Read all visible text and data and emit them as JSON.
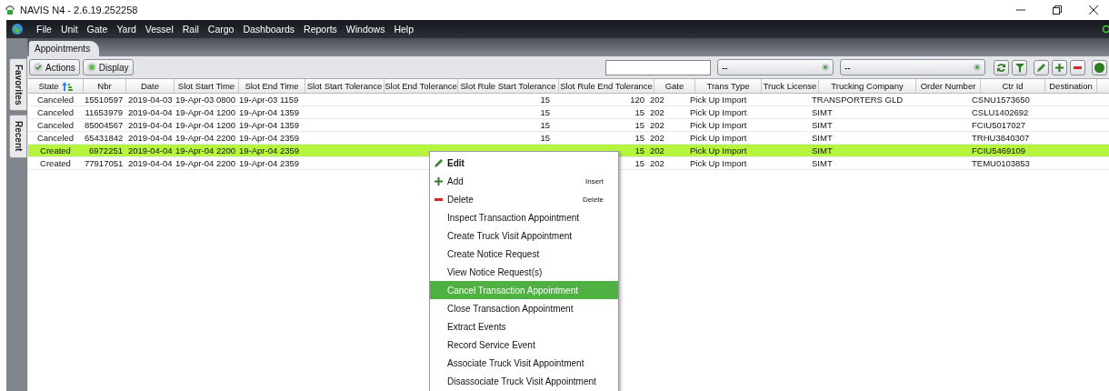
{
  "window": {
    "title": "NAVIS N4 - 2.6.19.252258"
  },
  "menu_bar": [
    "File",
    "Unit",
    "Gate",
    "Yard",
    "Vessel",
    "Rail",
    "Cargo",
    "Dashboards",
    "Reports",
    "Windows",
    "Help"
  ],
  "side_tabs": [
    "Favorites",
    "Recent"
  ],
  "tabs": [
    {
      "label": "Appointments",
      "selected": true
    }
  ],
  "toolbar": {
    "buttons": [
      {
        "label": "Actions",
        "kind": "check"
      },
      {
        "label": "Display",
        "kind": "square"
      }
    ],
    "dropdowns": [
      "--",
      "--"
    ]
  },
  "table": {
    "columns": [
      {
        "label": "State",
        "sorted": true
      },
      {
        "label": "Nbr",
        "sorted": false
      },
      {
        "label": "Date",
        "sorted": false
      },
      {
        "label": "Slot Start Time",
        "sorted": false
      },
      {
        "label": "Slot End Time",
        "sorted": false
      },
      {
        "label": "Slot Start Tolerance",
        "sorted": false
      },
      {
        "label": "Slot End Tolerance",
        "sorted": false
      },
      {
        "label": "Slot Rule Start Tolerance",
        "sorted": false
      },
      {
        "label": "Slot Rule End Tolerance",
        "sorted": false
      },
      {
        "label": "Gate",
        "sorted": false
      },
      {
        "label": "Trans Type",
        "sorted": false
      },
      {
        "label": "Truck License",
        "sorted": false
      },
      {
        "label": "Trucking Company",
        "sorted": false
      },
      {
        "label": "Order Number",
        "sorted": false
      },
      {
        "label": "Ctr Id",
        "sorted": false
      },
      {
        "label": "Destination",
        "sorted": false
      }
    ],
    "rows": [
      {
        "selected": false,
        "state": "Canceled",
        "nbr": "15510597",
        "date": "2019-04-03",
        "slot_start_time": "19-Apr-03 0800",
        "slot_end_time": "19-Apr-03 1159",
        "slot_rule_start_tolerance": "15",
        "slot_rule_end_tolerance": "120",
        "gate": "202",
        "trans_type": "Pick Up Import",
        "trucking_company": "TRANSPORTERS GLD",
        "ctr_id": "CSNU1573650"
      },
      {
        "selected": false,
        "state": "Canceled",
        "nbr": "11653979",
        "date": "2019-04-04",
        "slot_start_time": "19-Apr-04 1200",
        "slot_end_time": "19-Apr-04 1359",
        "slot_rule_start_tolerance": "15",
        "slot_rule_end_tolerance": "15",
        "gate": "202",
        "trans_type": "Pick Up Import",
        "trucking_company": "SIMT",
        "ctr_id": "CSLU1402692"
      },
      {
        "selected": false,
        "state": "Canceled",
        "nbr": "85004567",
        "date": "2019-04-04",
        "slot_start_time": "19-Apr-04 1200",
        "slot_end_time": "19-Apr-04 1359",
        "slot_rule_start_tolerance": "15",
        "slot_rule_end_tolerance": "15",
        "gate": "202",
        "trans_type": "Pick Up Import",
        "trucking_company": "SIMT",
        "ctr_id": "FCIU5017027"
      },
      {
        "selected": false,
        "state": "Canceled",
        "nbr": "65431842",
        "date": "2019-04-04",
        "slot_start_time": "19-Apr-04 2200",
        "slot_end_time": "19-Apr-04 2359",
        "slot_rule_start_tolerance": "15",
        "slot_rule_end_tolerance": "15",
        "gate": "202",
        "trans_type": "Pick Up Import",
        "trucking_company": "SIMT",
        "ctr_id": "TRHU3840307"
      },
      {
        "selected": true,
        "state": "Created",
        "nbr": "6972251",
        "date": "2019-04-04",
        "slot_start_time": "19-Apr-04 2200",
        "slot_end_time": "19-Apr-04 2359",
        "slot_rule_end_tolerance": "15",
        "gate": "202",
        "trans_type": "Pick Up Import",
        "trucking_company": "SIMT",
        "ctr_id": "FCIU5469109"
      },
      {
        "selected": false,
        "state": "Created",
        "nbr": "77917051",
        "date": "2019-04-04",
        "slot_start_time": "19-Apr-04 2200",
        "slot_end_time": "19-Apr-04 2359",
        "slot_rule_end_tolerance": "15",
        "gate": "202",
        "trans_type": "Pick Up Import",
        "trucking_company": "SIMT",
        "ctr_id": "TEMU0103853"
      }
    ]
  },
  "context_menu": [
    {
      "label": "Edit",
      "kind": "edit",
      "selected": false
    },
    {
      "label": "Add",
      "kind": "add",
      "shortcut": "Insert",
      "selected": false
    },
    {
      "label": "Delete",
      "kind": "delete",
      "shortcut": "Delete",
      "selected": false
    },
    {
      "label": "Inspect Transaction Appointment",
      "kind": "plain",
      "selected": false
    },
    {
      "label": "Create Truck Visit Appointment",
      "kind": "plain",
      "selected": false
    },
    {
      "label": "Create Notice Request",
      "kind": "plain",
      "selected": false
    },
    {
      "label": "View Notice Request(s)",
      "kind": "plain",
      "selected": false
    },
    {
      "label": "Cancel Transaction Appointment",
      "kind": "plain",
      "selected": true
    },
    {
      "label": "Close Transaction Appointment",
      "kind": "plain",
      "selected": false
    },
    {
      "label": "Extract Events",
      "kind": "plain",
      "selected": false
    },
    {
      "label": "Record Service Event",
      "kind": "plain",
      "selected": false
    },
    {
      "label": "Associate Truck Visit Appointment",
      "kind": "plain",
      "selected": false
    },
    {
      "label": "Disassociate Truck Visit Appointment",
      "kind": "plain",
      "selected": false
    }
  ]
}
